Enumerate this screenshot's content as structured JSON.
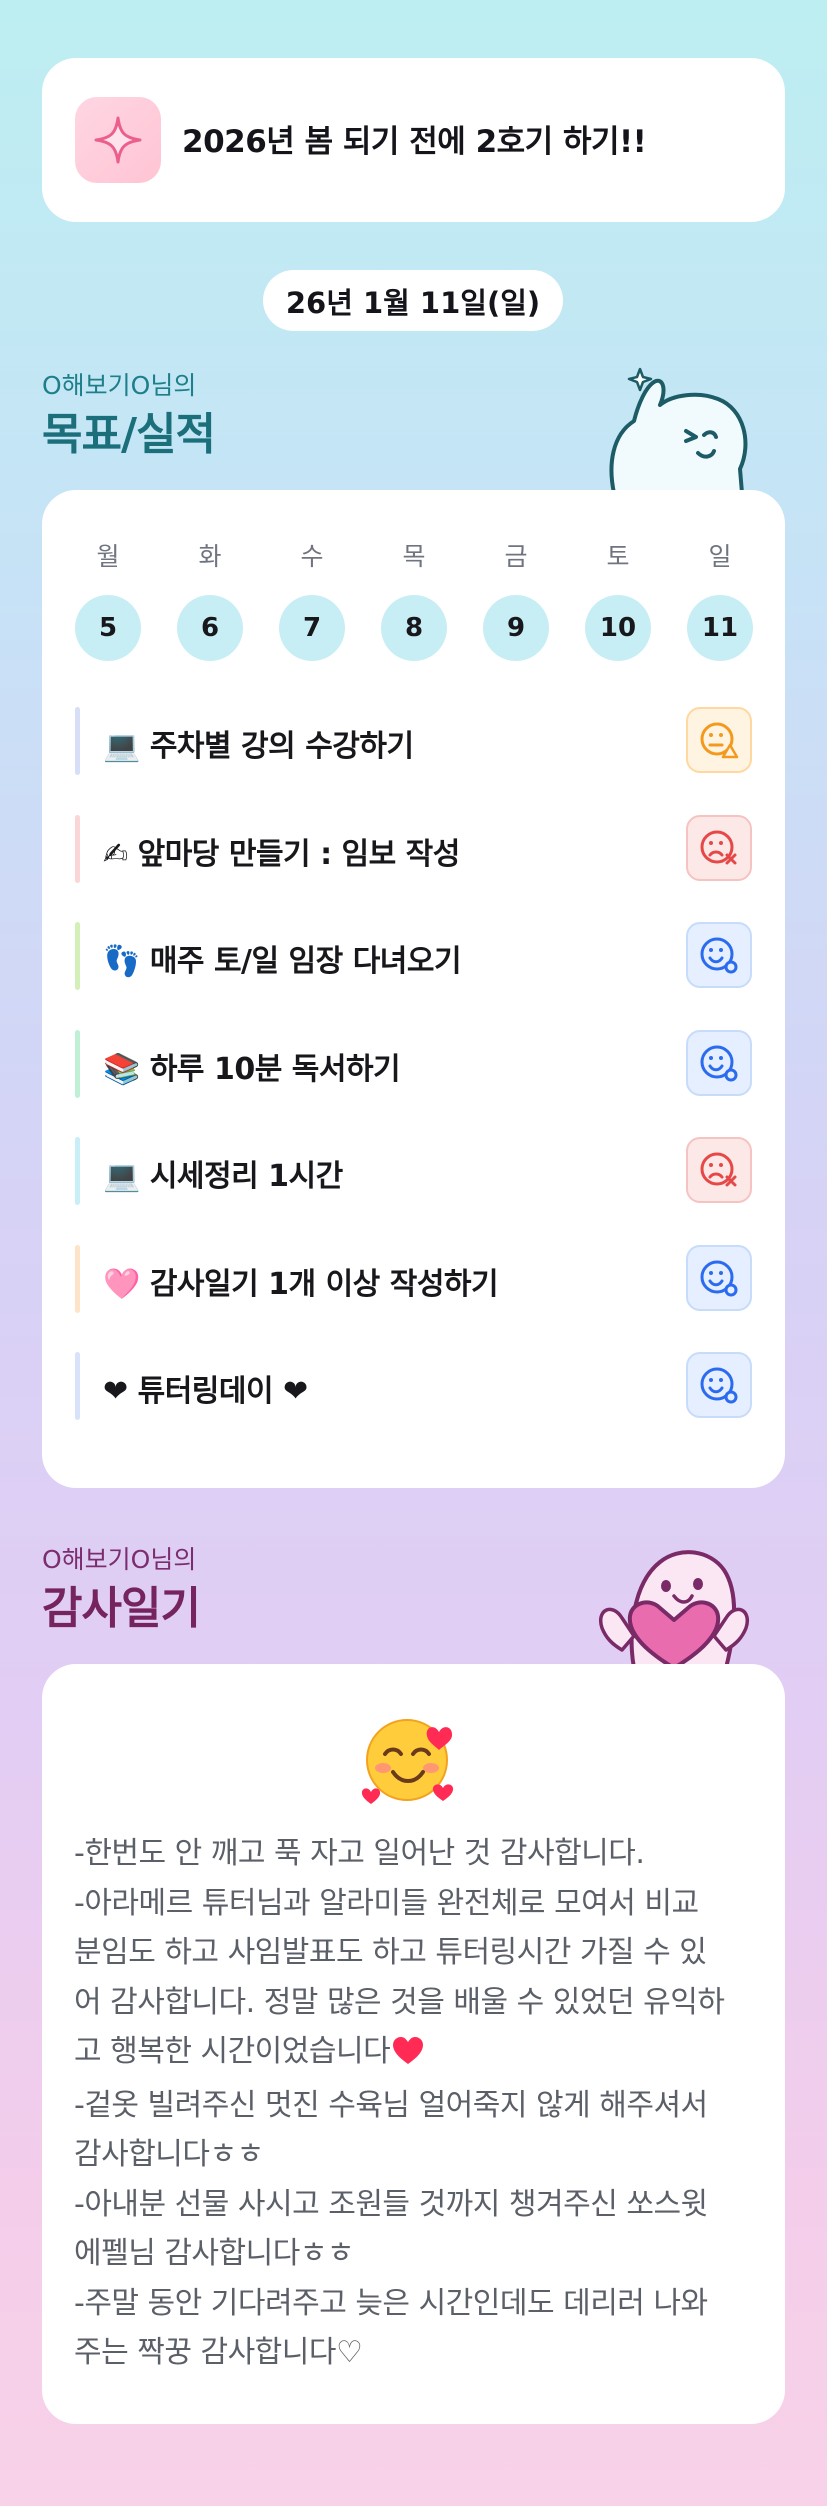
{
  "goal_banner": {
    "text": "2026년 봄 되기 전에 2호기 하기!!",
    "icon": "sparkle-icon"
  },
  "date": "26년 1월 11일(일)",
  "goals_section": {
    "subtitle": "O해보기O님의",
    "title": "목표/실적"
  },
  "week": {
    "days": [
      "월",
      "화",
      "수",
      "목",
      "금",
      "토",
      "일"
    ],
    "dates": [
      "5",
      "6",
      "7",
      "8",
      "9",
      "10",
      "11"
    ]
  },
  "goals": [
    {
      "emoji": "💻",
      "text": "주차별 강의 수강하기",
      "status": "partial",
      "bar_color": "#d7def8"
    },
    {
      "emoji": "✍",
      "text": "앞마당 만들기 : 임보 작성",
      "status": "fail",
      "bar_color": "#fbd6d6"
    },
    {
      "emoji": "👣",
      "text": "매주 토/일 임장 다녀오기",
      "status": "done",
      "bar_color": "#d2f0b8"
    },
    {
      "emoji": "📚",
      "text": "하루 10분 독서하기",
      "status": "done",
      "bar_color": "#bff0d6"
    },
    {
      "emoji": "💻",
      "text": "시세정리 1시간",
      "status": "fail",
      "bar_color": "#c8eef8"
    },
    {
      "emoji": "🩷",
      "text": "감사일기 1개 이상 작성하기",
      "status": "done",
      "bar_color": "#fde3c8"
    },
    {
      "emoji": "❤",
      "text": "튜터링데이 ❤",
      "status": "done",
      "bar_color": "#d8e3fb"
    }
  ],
  "gratitude_section": {
    "subtitle": "O해보기O님의",
    "title": "감사일기"
  },
  "gratitude": {
    "emoji": "smiling-face-with-hearts-icon",
    "lines": [
      "-한번도 안 깨고 푹 자고 일어난 것 감사합니다.",
      "-아라메르 튜터님과 알라미들 완전체로 모여서 비교",
      "분임도 하고 사임발표도 하고 튜터링시간 가질 수 있",
      "어 감사합니다. 정말 많은 것을 배울 수 있었던 유익하",
      "고 행복한 시간이었습니다",
      "-겉옷 빌려주신 멋진 수육님 얼어죽지 않게 해주셔서",
      "감사합니다ㅎㅎ",
      "-아내분 선물 사시고 조원들 것까지 챙겨주신 쏘스윗",
      "에펠님 감사합니다ㅎㅎ",
      "-주말 동안 기다려주고 늦은 시간인데도 데리러 나와",
      "주는 짝꿍 감사합니다♡"
    ]
  },
  "colors": {
    "accent_teal": "#1b6f7a",
    "accent_plum": "#76245f",
    "day_circle": "#c7eef4"
  }
}
